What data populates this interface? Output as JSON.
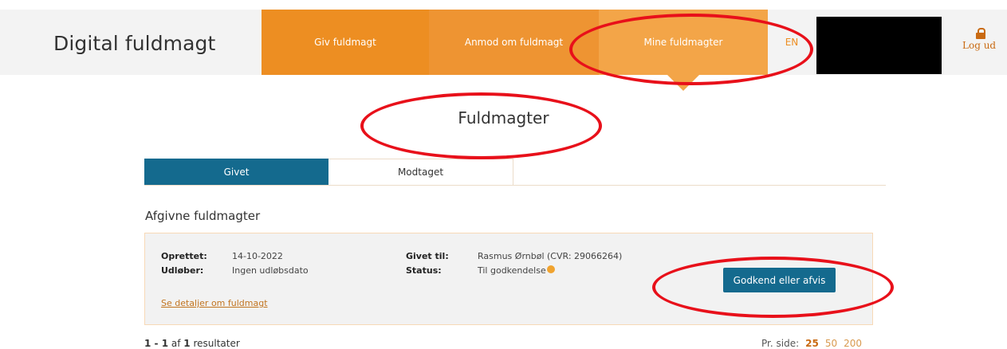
{
  "header": {
    "brand": "Digital fuldmagt",
    "nav": {
      "give": "Giv fuldmagt",
      "request": "Anmod om fuldmagt",
      "mine": "Mine fuldmagter",
      "language": "EN"
    },
    "logout": "Log ud",
    "colors": {
      "nav_orange": "#ed8e22",
      "nav_active": "#f3a548"
    }
  },
  "page_title": "Fuldmagter",
  "tabs": {
    "given": "Givet",
    "received": "Modtaget",
    "active_color": "#146a8e"
  },
  "section_title": "Afgivne fuldmagter",
  "card": {
    "created_label": "Oprettet:",
    "created_value": "14-10-2022",
    "expires_label": "Udløber:",
    "expires_value": "Ingen udløbsdato",
    "given_to_label": "Givet til:",
    "given_to_value": "Rasmus Ørnbøl (CVR: 29066264)",
    "status_label": "Status:",
    "status_value": "Til godkendelse",
    "status_color": "#f0a32f",
    "details_link": "Se detaljer om fuldmagt",
    "approve_button": "Godkend eller afvis"
  },
  "results": {
    "from": "1",
    "sep": " - ",
    "to": "1",
    "of": " af ",
    "total": "1",
    "suffix": " resultater"
  },
  "page_size": {
    "label": "Pr. side:",
    "options": [
      "25",
      "50",
      "200"
    ],
    "selected": "25"
  },
  "annotation_color": "#e8101a"
}
